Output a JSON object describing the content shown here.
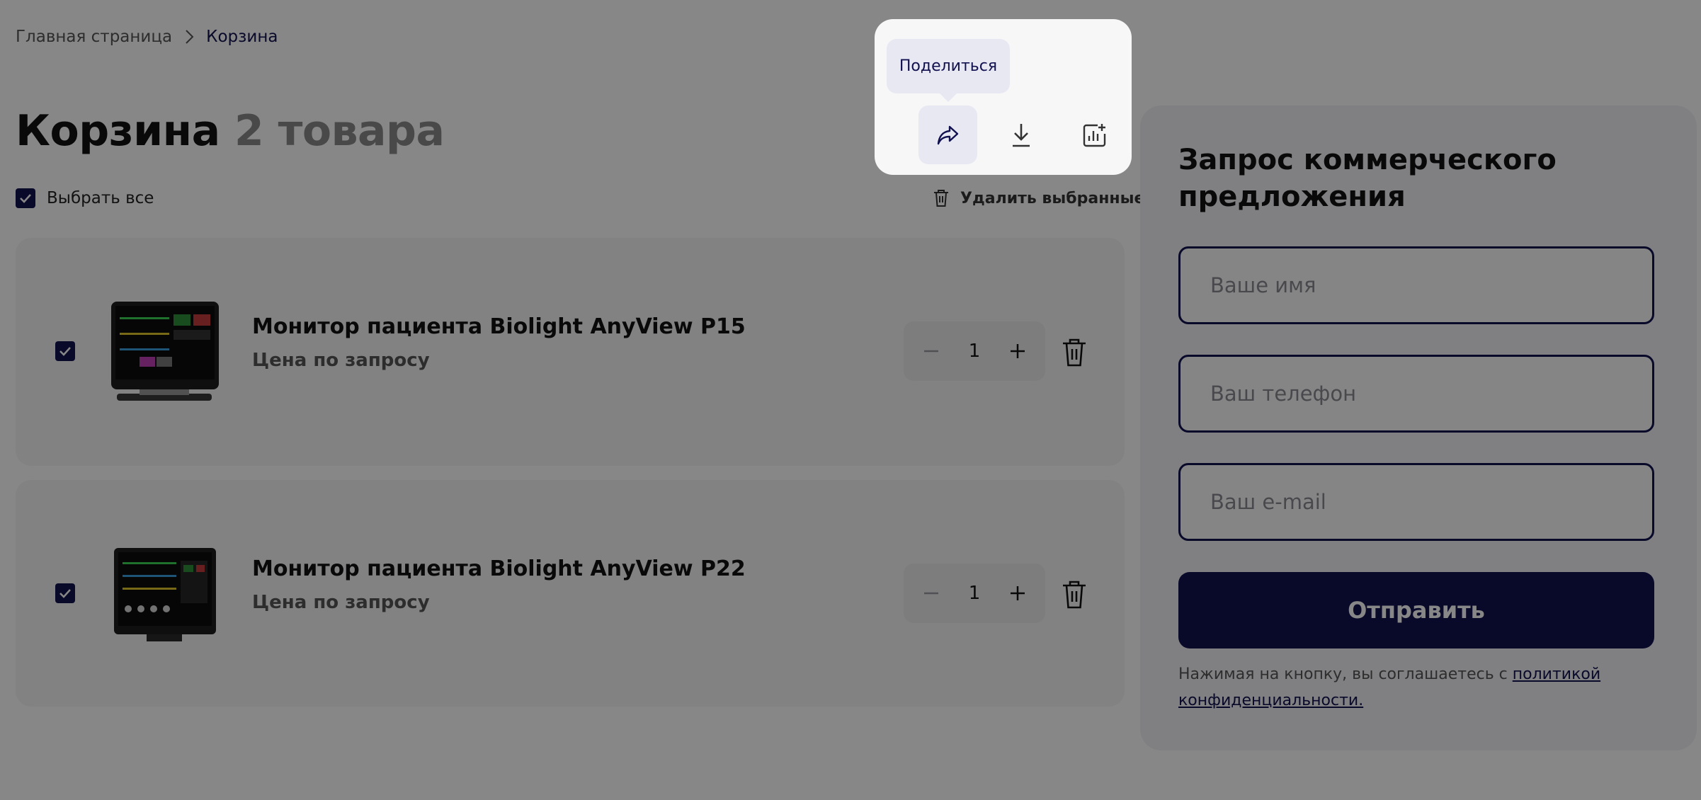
{
  "breadcrumb": {
    "home": "Главная страница",
    "current": "Корзина"
  },
  "cart": {
    "title": "Корзина",
    "count_label": "2 товара",
    "select_all_label": "Выбрать все",
    "delete_selected_label": "Удалить выбранные",
    "items": [
      {
        "name": "Монитор пациента Biolight AnyView P15",
        "price": "Цена по запросу",
        "quantity": "1",
        "checked": true
      },
      {
        "name": "Монитор пациента Biolight AnyView P22",
        "price": "Цена по запросу",
        "quantity": "1",
        "checked": true
      }
    ]
  },
  "form": {
    "title": "Запрос коммерческого предложения",
    "name_placeholder": "Ваше имя",
    "phone_placeholder": "Ваш телефон",
    "email_placeholder": "Ваш e-mail",
    "submit_label": "Отправить",
    "consent_text": "Нажимая на кнопку, вы соглашаетесь с ",
    "consent_link": "политикой конфиденциальности."
  },
  "popup": {
    "tooltip": "Поделиться",
    "actions": [
      {
        "icon": "share-icon",
        "active": true
      },
      {
        "icon": "download-icon",
        "active": false
      },
      {
        "icon": "add-to-compare-icon",
        "active": false
      }
    ]
  },
  "colors": {
    "accent": "#121150",
    "overlay": "rgba(0,0,0,0.47)",
    "card_bg": "#f6f6f7",
    "panel_bg": "#f1f1f7"
  }
}
